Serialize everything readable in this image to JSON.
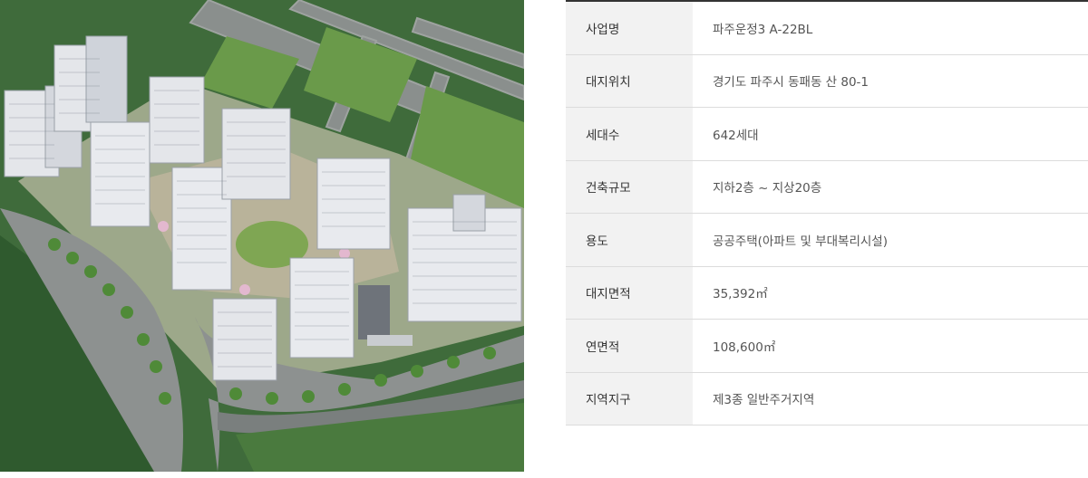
{
  "image": {
    "alt": ""
  },
  "table": {
    "rows": [
      {
        "label": "사업명",
        "value": "파주운정3 A-22BL"
      },
      {
        "label": "대지위치",
        "value": "경기도 파주시 동패동 산 80-1"
      },
      {
        "label": "세대수",
        "value": "642세대"
      },
      {
        "label": "건축규모",
        "value": "지하2층 ~ 지상20층"
      },
      {
        "label": "용도",
        "value": "공공주택(아파트 및 부대복리시설)"
      },
      {
        "label": "대지면적",
        "value": "35,392㎡"
      },
      {
        "label": "연면적",
        "value": "108,600㎡"
      },
      {
        "label": "지역지구",
        "value": "제3종 일반주거지역"
      }
    ]
  },
  "colors": {
    "header_bg": "#f2f2f2",
    "border": "#dcdcdc",
    "top_border": "#333333"
  }
}
